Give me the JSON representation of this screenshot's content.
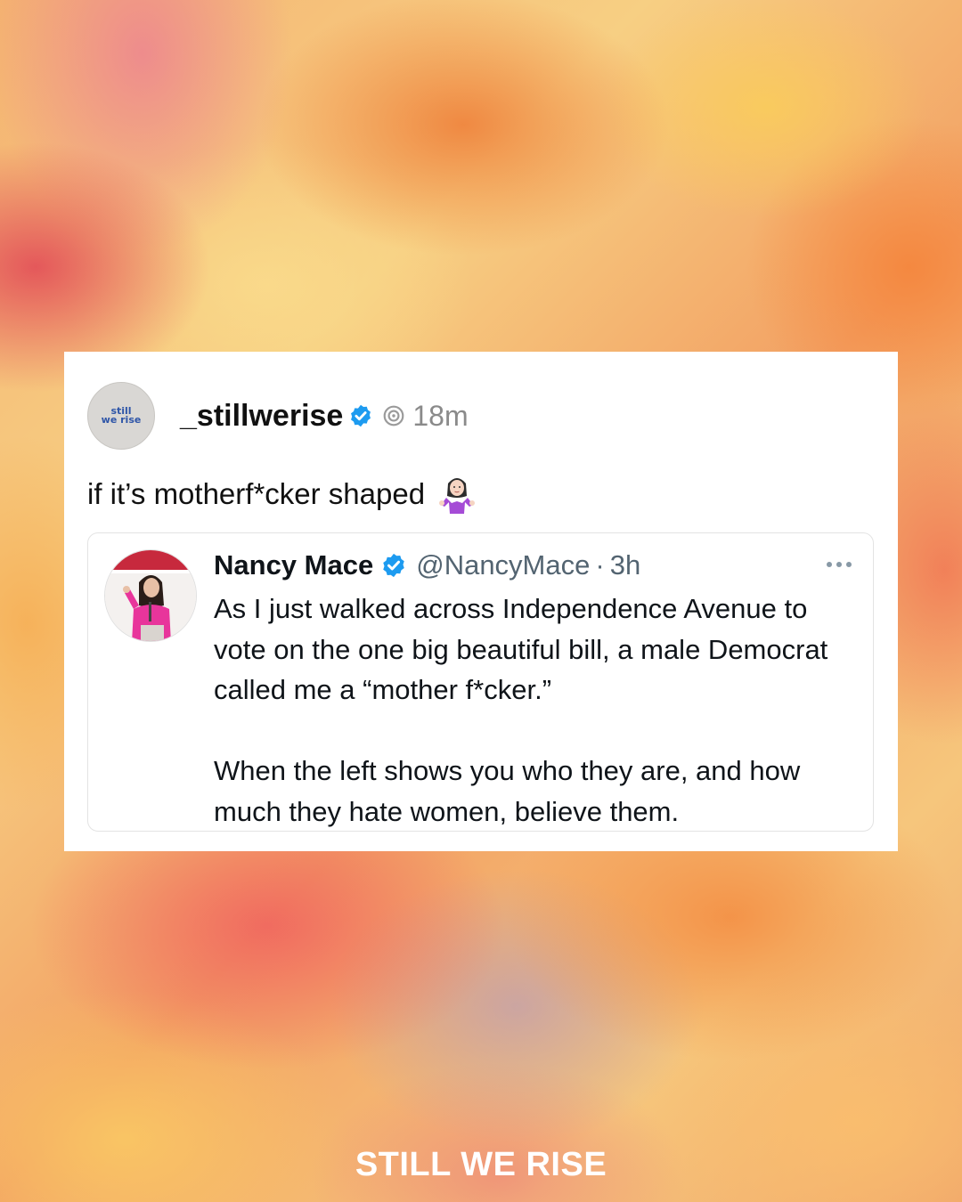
{
  "post": {
    "avatar_logo_text": "still\nwe rise",
    "username": "_stillwerise",
    "time": "18m",
    "text": "if it’s motherf*cker shaped",
    "emoji_icon": "woman-shrugging-icon"
  },
  "quoted_tweet": {
    "name": "Nancy Mace",
    "handle": "@NancyMace",
    "separator": "·",
    "time": "3h",
    "paragraph1": "As I just walked across Independence Avenue to vote on the one big beautiful bill, a male Democrat called me a “mother f*cker.”",
    "paragraph2": "When the left shows you who they are, and how much they hate women, believe them."
  },
  "footer": {
    "brand": "STILL WE RISE"
  },
  "colors": {
    "verified_blue": "#1d9bf0",
    "card_background": "#ffffff",
    "muted_text": "#8a8a8a"
  }
}
